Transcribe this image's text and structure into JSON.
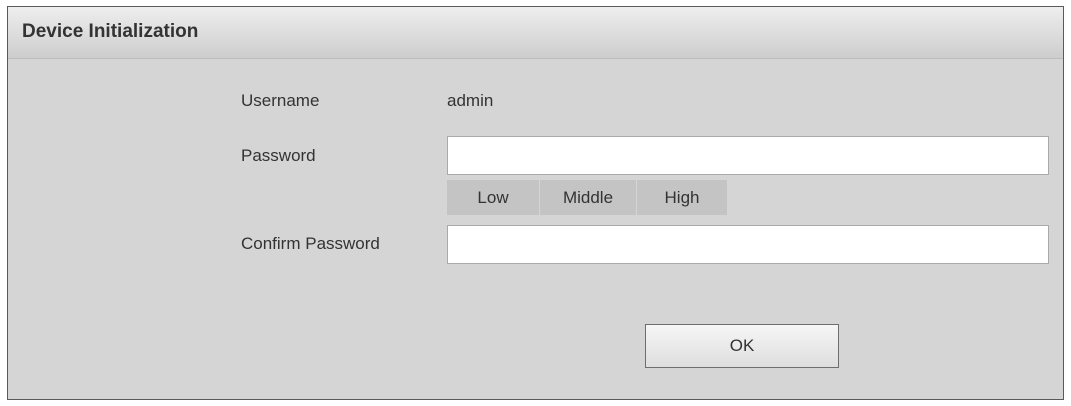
{
  "dialog": {
    "title": "Device Initialization"
  },
  "form": {
    "username_label": "Username",
    "username_value": "admin",
    "password_label": "Password",
    "password_value": "",
    "confirm_label": "Confirm Password",
    "confirm_value": "",
    "strength_levels": [
      "Low",
      "Middle",
      "High"
    ]
  },
  "actions": {
    "ok_label": "OK"
  },
  "colors": {
    "dialog_background": "#d5d5d5",
    "titlebar_background": "#dcdcdc",
    "strength_background": "#c4c4c4",
    "text": "#333333"
  }
}
